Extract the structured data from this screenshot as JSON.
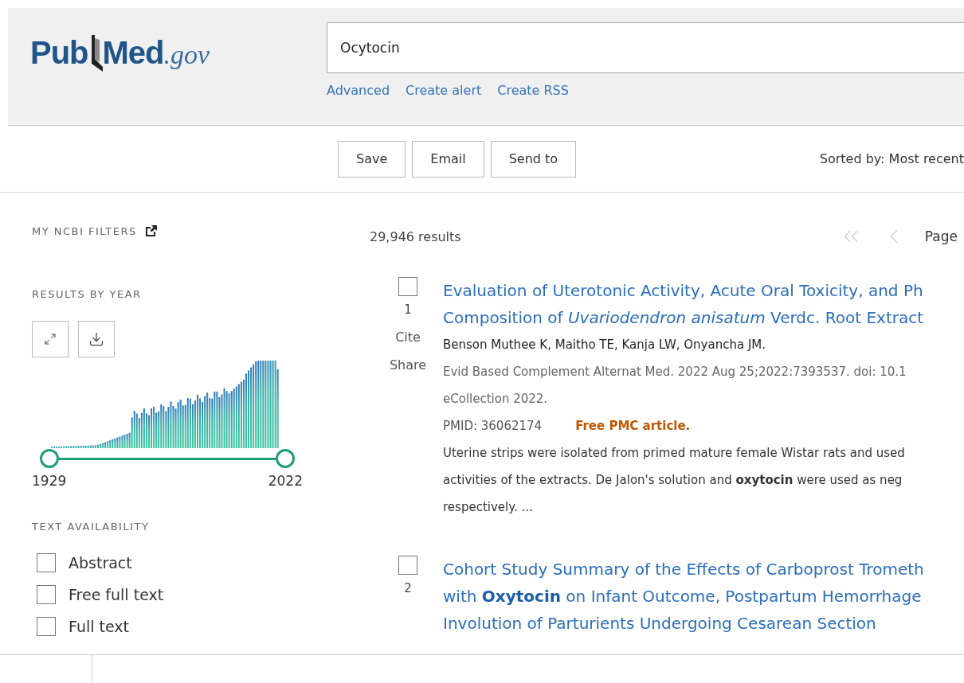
{
  "logo": {
    "part_1": "Pub",
    "part_2": "Med",
    "suffix": ".gov"
  },
  "search": {
    "value": "Ocytocin"
  },
  "search_links": [
    "Advanced",
    "Create alert",
    "Create RSS"
  ],
  "actions": [
    "Save",
    "Email",
    "Send to"
  ],
  "sort": "Sorted by: Most recent",
  "sidebar": {
    "filters_heading": "MY NCBI FILTERS",
    "year_heading": "RESULTS BY YEAR",
    "year_slider": {
      "handles": [
        {
          "level": 0
        },
        {
          "level": 1
        }
      ],
      "start_label": "1929",
      "end_label": "2022"
    },
    "availability_heading": "TEXT AVAILABILITY",
    "availability": [
      {
        "label": "Abstract",
        "checked": false
      },
      {
        "label": "Free full text",
        "checked": false
      },
      {
        "label": "Full text",
        "checked": false
      }
    ]
  },
  "results_count": "29,946 results",
  "pagination": {
    "buttons": [
      {
        "kind": "first",
        "disabled": true
      },
      {
        "kind": "prev",
        "disabled": true
      }
    ],
    "label": "Page"
  },
  "results": [
    {
      "number": "1",
      "checked": false,
      "actions": [
        "Cite",
        "Share"
      ],
      "title_lines": [
        "Evaluation of Uterotonic Activity, Acute Oral Toxicity, and Ph",
        "Composition of *Uvariodendron anisatum* Verdc. Root Extract"
      ],
      "authors": "Benson Muthee K, Maitho TE, Kanja LW, Onyancha JM.",
      "citation_lines": [
        "Evid Based Complement Alternat Med. 2022 Aug 25;2022:7393537. doi: 10.1",
        "eCollection 2022."
      ],
      "pmid": "PMID: 36062174",
      "free_tag": "Free PMC article.",
      "snippet_lines": [
        "Uterine strips were isolated from primed mature female Wistar rats and used",
        "activities of the extracts. De Jalon's solution and **oxytocin** were used as neg",
        "respectively. ..."
      ]
    },
    {
      "number": "2",
      "checked": false,
      "title_lines": [
        "Cohort Study Summary of the Effects of Carboprost Trometh",
        "with **Oxytocin** on Infant Outcome, Postpartum Hemorrhage",
        "Involution of Parturients Undergoing Cesarean Section"
      ]
    }
  ]
}
